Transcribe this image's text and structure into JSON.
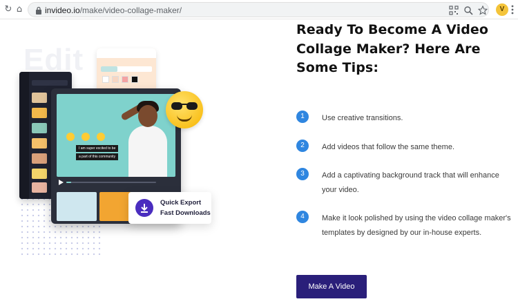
{
  "browser": {
    "url_domain": "invideo.io",
    "url_path": "/make/video-collage-maker/",
    "profile_initial": "V",
    "icons": [
      "reload-icon",
      "home-icon",
      "lock-icon",
      "qr-icon",
      "zoom-icon",
      "star-icon",
      "menu-icon"
    ]
  },
  "illustration": {
    "watermark": "Edit",
    "export_line1": "Quick Export",
    "export_line2": "Fast Downloads",
    "caption_line1": "I am super excited to be",
    "caption_line2": "a part of this community"
  },
  "content": {
    "heading": "Ready To Become A Video Collage Maker? Here Are Some Tips:",
    "tips": [
      {
        "number": "1",
        "text": "Use creative transitions."
      },
      {
        "number": "2",
        "text": "Add videos that follow the same theme."
      },
      {
        "number": "3",
        "text": "Add a captivating background track that will enhance your video."
      },
      {
        "number": "4",
        "text": "Make it look polished by using the video collage maker's templates by designed by our in-house experts."
      }
    ],
    "cta_label": "Make A Video"
  },
  "colors": {
    "accent": "#2f86e0",
    "cta": "#2a1f7a",
    "export_icon": "#4a2dbf",
    "video_bg": "#7fd2cc"
  },
  "player": {
    "progress_fraction": 0.05
  }
}
